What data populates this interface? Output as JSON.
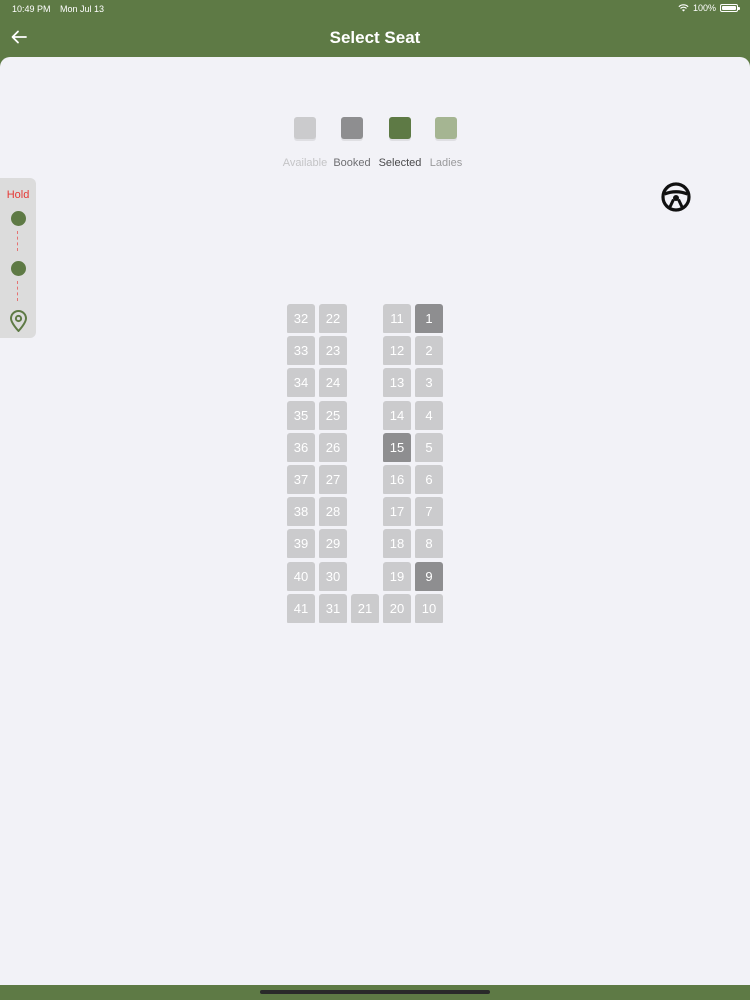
{
  "status_bar": {
    "time": "10:49 PM",
    "date": "Mon Jul 13",
    "battery": "100%",
    "battery_level": 1.0
  },
  "nav": {
    "title": "Select Seat",
    "back_icon": "arrow-left-icon"
  },
  "legend": [
    {
      "key": "available",
      "label": "Available",
      "color": "#cbcbcd",
      "label_color": "#c4c4c6"
    },
    {
      "key": "booked",
      "label": "Booked",
      "color": "#8e8e90",
      "label_color": "#6f6f72"
    },
    {
      "key": "selected",
      "label": "Selected",
      "color": "#5e7a45",
      "label_color": "#4a4a4c"
    },
    {
      "key": "ladies",
      "label": "Ladies",
      "color": "#a5b592",
      "label_color": "#9a9a9c"
    }
  ],
  "hold_panel": {
    "label": "Hold",
    "icons": [
      "dot-icon",
      "dot-icon",
      "location-pin-icon"
    ]
  },
  "steering_icon": "steering-wheel-icon",
  "colors": {
    "header": "#5e7a45",
    "sheet": "#f2f2f7",
    "available": "#cbcbcd",
    "booked": "#8e8e90"
  },
  "seat_columns": [
    {
      "col": 0,
      "seats": [
        "32",
        "33",
        "34",
        "35",
        "36",
        "37",
        "38",
        "39",
        "40",
        "41"
      ]
    },
    {
      "col": 1,
      "seats": [
        "22",
        "23",
        "24",
        "25",
        "26",
        "27",
        "28",
        "29",
        "30",
        "31"
      ]
    },
    {
      "col": 2,
      "seats": [
        "",
        "",
        "",
        "",
        "",
        "",
        "",
        "",
        "",
        "21"
      ]
    },
    {
      "col": 3,
      "seats": [
        "11",
        "12",
        "13",
        "14",
        "15",
        "16",
        "17",
        "18",
        "19",
        "20"
      ]
    },
    {
      "col": 4,
      "seats": [
        "1",
        "2",
        "3",
        "4",
        "5",
        "6",
        "7",
        "8",
        "9",
        "10"
      ]
    }
  ],
  "booked_seats": [
    "1",
    "15",
    "9"
  ]
}
